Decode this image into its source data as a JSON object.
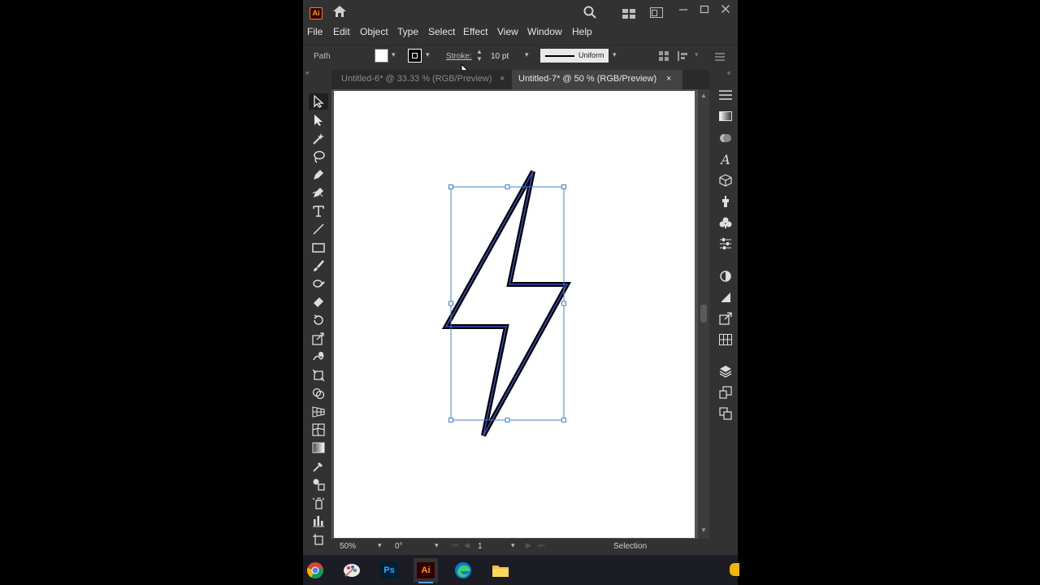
{
  "app": {
    "logo": "Ai"
  },
  "menu": [
    "File",
    "Edit",
    "Object",
    "Type",
    "Select",
    "Effect",
    "View",
    "Window",
    "Help"
  ],
  "control_bar": {
    "object_type": "Path",
    "stroke_label": "Stroke:",
    "stroke_weight": "10 pt",
    "profile": "Uniform"
  },
  "tabs": [
    {
      "label": "Untitled-6* @ 33.33 % (RGB/Preview)",
      "close": "×"
    },
    {
      "label": "Untitled-7* @ 50 % (RGB/Preview)",
      "close": "×"
    }
  ],
  "status": {
    "zoom": "50%",
    "rotation": "0°",
    "artboard_number": "1",
    "tool_name": "Selection"
  },
  "taskbar": {
    "ps_label": "Ps",
    "ai_label": "Ai"
  },
  "colors": {
    "ui_bg": "#323232",
    "canvas_bg": "#535353",
    "selection_blue": "#4a7fc1",
    "ai_orange": "#ff9a00"
  }
}
